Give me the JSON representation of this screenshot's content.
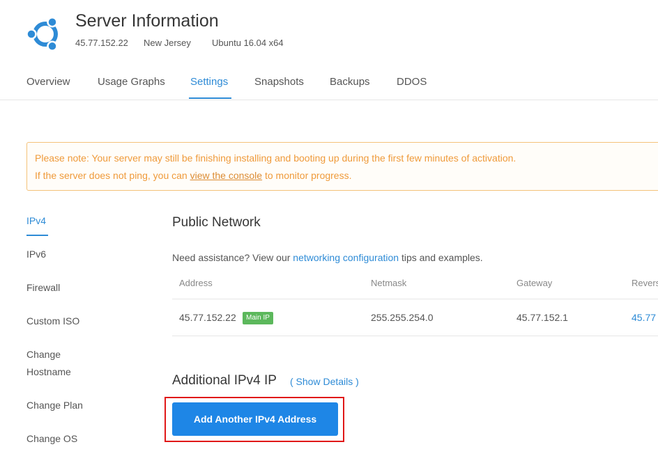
{
  "header": {
    "title": "Server Information",
    "ip": "45.77.152.22",
    "location": "New Jersey",
    "os": "Ubuntu 16.04 x64",
    "logo_icon": "ubuntu-logo-icon",
    "logo_color": "#2e8bd6"
  },
  "tabs": [
    {
      "label": "Overview",
      "active": false
    },
    {
      "label": "Usage Graphs",
      "active": false
    },
    {
      "label": "Settings",
      "active": true
    },
    {
      "label": "Snapshots",
      "active": false
    },
    {
      "label": "Backups",
      "active": false
    },
    {
      "label": "DDOS",
      "active": false
    }
  ],
  "notice": {
    "line1": "Please note: Your server may still be finishing installing and booting up during the first few minutes of activation.",
    "line2_before": "If the server does not ping, you can ",
    "line2_link": "view the console",
    "line2_after": " to monitor progress."
  },
  "sidebar": {
    "items": [
      {
        "label": "IPv4",
        "active": true
      },
      {
        "label": "IPv6",
        "active": false
      },
      {
        "label": "Firewall",
        "active": false
      },
      {
        "label": "Custom ISO",
        "active": false
      },
      {
        "label": "Change Hostname",
        "active": false
      },
      {
        "label": "Change Plan",
        "active": false
      },
      {
        "label": "Change OS",
        "active": false
      }
    ]
  },
  "main": {
    "section_title": "Public Network",
    "assist_before": "Need assistance? View our ",
    "assist_link": "networking configuration",
    "assist_after": " tips and examples.",
    "table": {
      "headers": [
        "Address",
        "Netmask",
        "Gateway",
        "Reverse DNS"
      ],
      "rows": [
        {
          "address": "45.77.152.22",
          "badge": "Main IP",
          "netmask": "255.255.254.0",
          "gateway": "45.77.152.1",
          "reverse": "45.77"
        }
      ]
    },
    "additional_title": "Additional IPv4 IP",
    "show_details": "( Show Details )",
    "add_button": "Add Another IPv4 Address"
  },
  "colors": {
    "accent": "#2e8bd6",
    "notice_text": "#ef9a3a",
    "notice_border": "#f4c27a",
    "badge": "#5cb85c",
    "button": "#1e86e6",
    "highlight": "#e01818"
  }
}
